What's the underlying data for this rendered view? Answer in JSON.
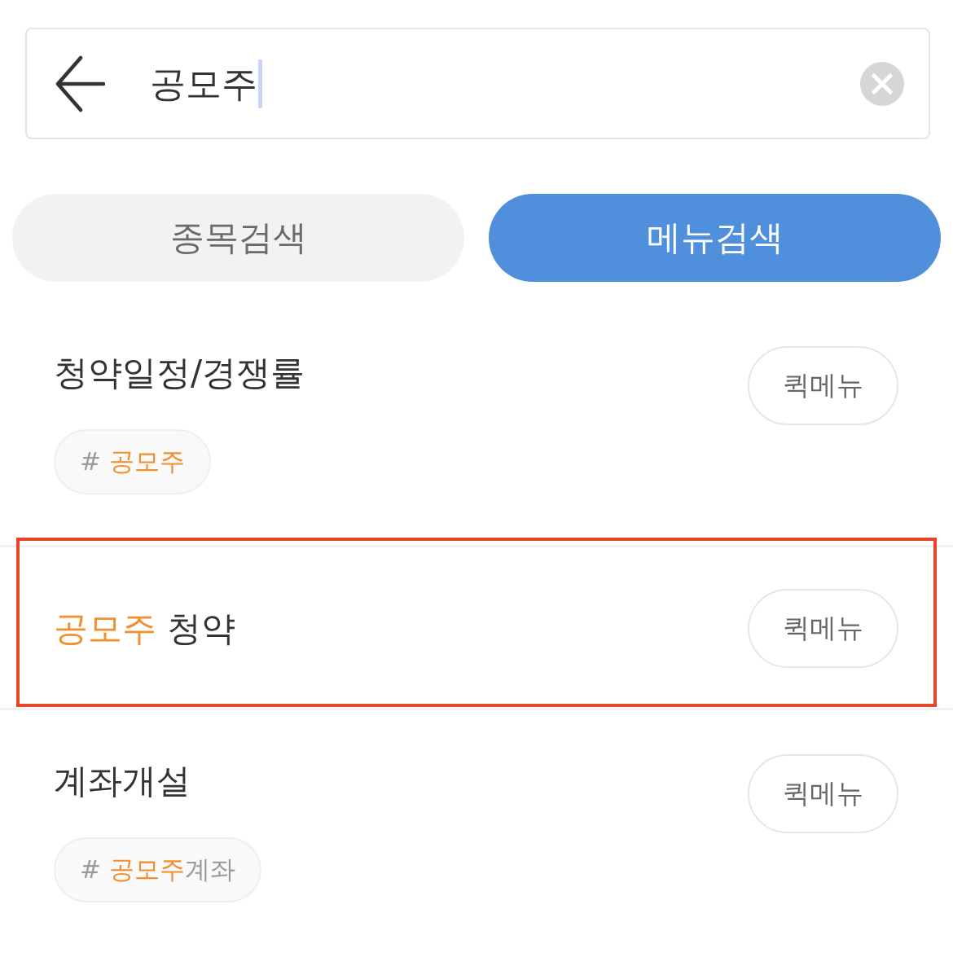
{
  "search": {
    "value": "공모주",
    "focused": true
  },
  "tabs": [
    {
      "label": "종목검색",
      "selected": false
    },
    {
      "label": "메뉴검색",
      "selected": true
    }
  ],
  "results": [
    {
      "title_parts": [
        {
          "text": "청약일정/경쟁률",
          "highlighted": false
        }
      ],
      "quick_button": "퀵메뉴",
      "annotated": false,
      "tags": [
        {
          "parts": [
            {
              "text": "# ",
              "highlighted": false
            },
            {
              "text": "공모주",
              "highlighted": true
            }
          ]
        }
      ]
    },
    {
      "title_parts": [
        {
          "text": "공모주",
          "highlighted": true
        },
        {
          "text": " 청약",
          "highlighted": false
        }
      ],
      "quick_button": "퀵메뉴",
      "annotated": true
    },
    {
      "title_parts": [
        {
          "text": "계좌개설",
          "highlighted": false
        }
      ],
      "quick_button": "퀵메뉴",
      "annotated": false,
      "tags": [
        {
          "parts": [
            {
              "text": "# ",
              "highlighted": false
            },
            {
              "text": "공모주",
              "highlighted": true
            },
            {
              "text": "계좌",
              "highlighted": false
            }
          ]
        }
      ]
    }
  ]
}
